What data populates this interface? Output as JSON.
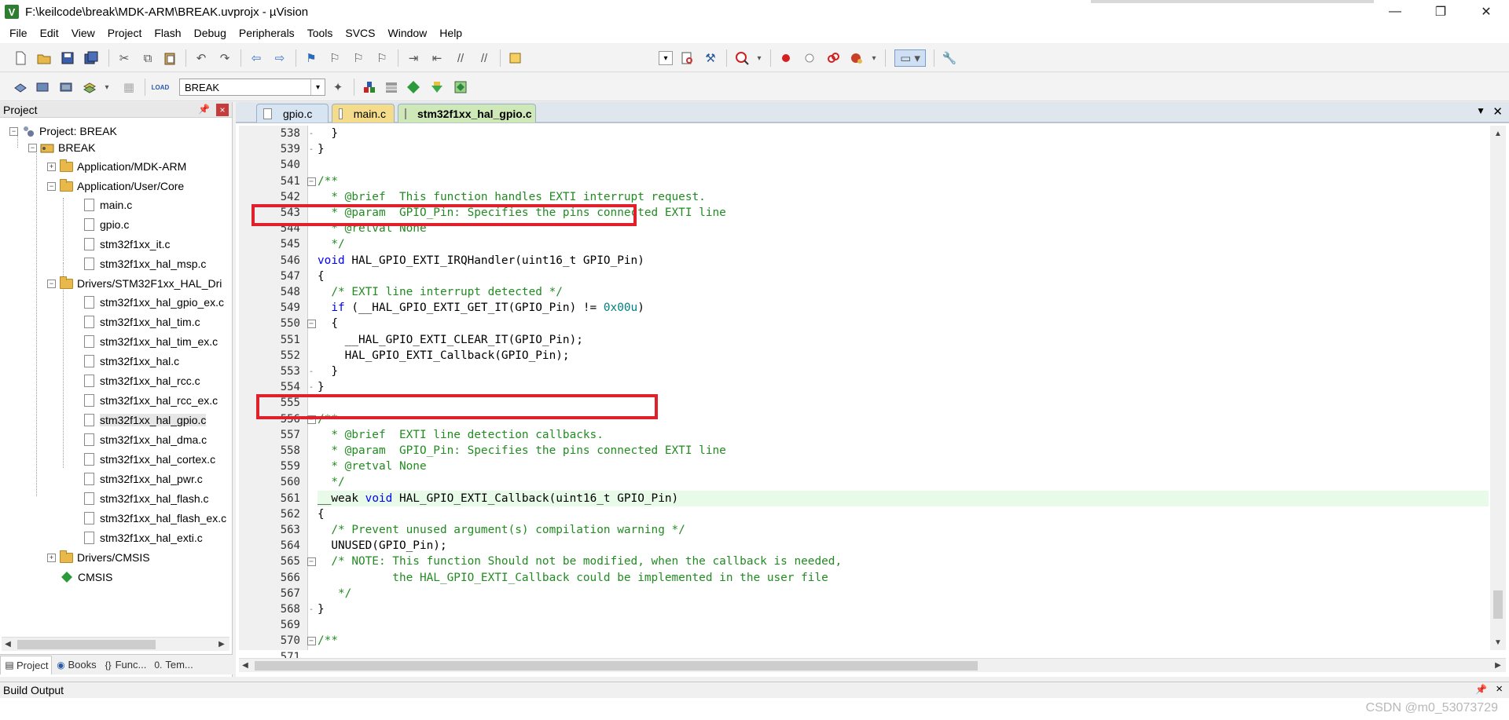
{
  "window": {
    "title": "F:\\keilcode\\break\\MDK-ARM\\BREAK.uvprojx - µVision",
    "app_icon_letter": "V",
    "minimize": "—",
    "maximize": "❐",
    "close": "✕"
  },
  "menu": [
    "File",
    "Edit",
    "View",
    "Project",
    "Flash",
    "Debug",
    "Peripherals",
    "Tools",
    "SVCS",
    "Window",
    "Help"
  ],
  "toolbar": {
    "target": "BREAK",
    "load_label": "LOAD"
  },
  "project_panel": {
    "title": "Project",
    "pin": "📌",
    "close": "×",
    "tree": {
      "root": "Project: BREAK",
      "target": "BREAK",
      "groups": [
        {
          "name": "Application/MDK-ARM"
        },
        {
          "name": "Application/User/Core",
          "files": [
            "main.c",
            "gpio.c",
            "stm32f1xx_it.c",
            "stm32f1xx_hal_msp.c"
          ]
        },
        {
          "name": "Drivers/STM32F1xx_HAL_Dri",
          "files": [
            "stm32f1xx_hal_gpio_ex.c",
            "stm32f1xx_hal_tim.c",
            "stm32f1xx_hal_tim_ex.c",
            "stm32f1xx_hal.c",
            "stm32f1xx_hal_rcc.c",
            "stm32f1xx_hal_rcc_ex.c",
            "stm32f1xx_hal_gpio.c",
            "stm32f1xx_hal_dma.c",
            "stm32f1xx_hal_cortex.c",
            "stm32f1xx_hal_pwr.c",
            "stm32f1xx_hal_flash.c",
            "stm32f1xx_hal_flash_ex.c",
            "stm32f1xx_hal_exti.c"
          ]
        },
        {
          "name": "Drivers/CMSIS"
        }
      ],
      "cmsis": "CMSIS",
      "selected_file": "stm32f1xx_hal_gpio.c"
    },
    "tabs": [
      "Project",
      "Books",
      "Func...",
      "Tem..."
    ]
  },
  "editor": {
    "tabs": [
      "gpio.c",
      "main.c",
      "stm32f1xx_hal_gpio.c"
    ],
    "active_tab": "stm32f1xx_hal_gpio.c",
    "lines": [
      {
        "n": "538",
        "fold": "-",
        "parts": [
          [
            "",
            "  }"
          ]
        ]
      },
      {
        "n": "539",
        "fold": "-",
        "parts": [
          [
            "",
            "}"
          ]
        ]
      },
      {
        "n": "540",
        "fold": "",
        "parts": []
      },
      {
        "n": "541",
        "fold": "box",
        "parts": [
          [
            "cm",
            "/**"
          ]
        ]
      },
      {
        "n": "542",
        "fold": "",
        "parts": [
          [
            "cm",
            "  * @brief  This function handles EXTI interrupt request."
          ]
        ]
      },
      {
        "n": "543",
        "fold": "",
        "parts": [
          [
            "cm",
            "  * @param  GPIO_Pin: Specifies the pins connected EXTI line"
          ]
        ]
      },
      {
        "n": "544",
        "fold": "",
        "parts": [
          [
            "cm",
            "  * @retval None"
          ]
        ]
      },
      {
        "n": "545",
        "fold": "",
        "parts": [
          [
            "cm",
            "  */"
          ]
        ]
      },
      {
        "n": "546",
        "fold": "",
        "parts": [
          [
            "kw",
            "void"
          ],
          [
            "",
            " HAL_GPIO_EXTI_IRQHandler(uint16_t GPIO_Pin)"
          ]
        ]
      },
      {
        "n": "547",
        "fold": "",
        "parts": [
          [
            "",
            "{"
          ]
        ]
      },
      {
        "n": "548",
        "fold": "",
        "parts": [
          [
            "cm",
            "  /* EXTI line interrupt detected */"
          ]
        ]
      },
      {
        "n": "549",
        "fold": "",
        "parts": [
          [
            "",
            "  "
          ],
          [
            "kw",
            "if"
          ],
          [
            "",
            " (__HAL_GPIO_EXTI_GET_IT(GPIO_Pin) != "
          ],
          [
            "nm",
            "0x00u"
          ],
          [
            "",
            ")"
          ]
        ]
      },
      {
        "n": "550",
        "fold": "box",
        "parts": [
          [
            "",
            "  {"
          ]
        ]
      },
      {
        "n": "551",
        "fold": "",
        "parts": [
          [
            "",
            "    __HAL_GPIO_EXTI_CLEAR_IT(GPIO_Pin);"
          ]
        ]
      },
      {
        "n": "552",
        "fold": "",
        "parts": [
          [
            "",
            "    HAL_GPIO_EXTI_Callback(GPIO_Pin);"
          ]
        ]
      },
      {
        "n": "553",
        "fold": "-",
        "parts": [
          [
            "",
            "  }"
          ]
        ]
      },
      {
        "n": "554",
        "fold": "-",
        "parts": [
          [
            "",
            "}"
          ]
        ]
      },
      {
        "n": "555",
        "fold": "",
        "parts": []
      },
      {
        "n": "556",
        "fold": "box",
        "parts": [
          [
            "cm",
            "/**"
          ]
        ]
      },
      {
        "n": "557",
        "fold": "",
        "parts": [
          [
            "cm",
            "  * @brief  EXTI line detection callbacks."
          ]
        ]
      },
      {
        "n": "558",
        "fold": "",
        "parts": [
          [
            "cm",
            "  * @param  GPIO_Pin: Specifies the pins connected EXTI line"
          ]
        ]
      },
      {
        "n": "559",
        "fold": "",
        "parts": [
          [
            "cm",
            "  * @retval None"
          ]
        ]
      },
      {
        "n": "560",
        "fold": "",
        "parts": [
          [
            "cm",
            "  */"
          ]
        ]
      },
      {
        "n": "561",
        "fold": "",
        "parts": [
          [
            "",
            "__weak "
          ],
          [
            "kw",
            "void"
          ],
          [
            "",
            " HAL_GPIO_EXTI_Callback(uint16_t GPIO_Pin)"
          ]
        ]
      },
      {
        "n": "562",
        "fold": "",
        "parts": [
          [
            "",
            "{"
          ]
        ]
      },
      {
        "n": "563",
        "fold": "",
        "parts": [
          [
            "cm",
            "  /* Prevent unused argument(s) compilation warning */"
          ]
        ]
      },
      {
        "n": "564",
        "fold": "",
        "parts": [
          [
            "",
            "  UNUSED(GPIO_Pin);"
          ]
        ]
      },
      {
        "n": "565",
        "fold": "box",
        "parts": [
          [
            "cm",
            "  /* NOTE: This function Should not be modified, when the callback is needed,"
          ]
        ]
      },
      {
        "n": "566",
        "fold": "",
        "parts": [
          [
            "cm",
            "           the HAL_GPIO_EXTI_Callback could be implemented in the user file"
          ]
        ]
      },
      {
        "n": "567",
        "fold": "",
        "parts": [
          [
            "cm",
            "   */"
          ]
        ]
      },
      {
        "n": "568",
        "fold": "-",
        "parts": [
          [
            "",
            "}"
          ]
        ]
      },
      {
        "n": "569",
        "fold": "",
        "parts": []
      },
      {
        "n": "570",
        "fold": "box",
        "parts": [
          [
            "cm",
            "/**"
          ]
        ]
      },
      {
        "n": "571",
        "fold": "",
        "parts": [
          [
            "cm",
            "  * @}"
          ]
        ]
      }
    ],
    "highlighted_line": "561"
  },
  "build_output": {
    "title": "Build Output",
    "pin": "📌",
    "close": "×"
  },
  "watermark": "CSDN @m0_53073729",
  "colors": {
    "comment": "#228b22",
    "keyword": "#0000ff",
    "number": "#008080",
    "annotation_box": "#e0202a",
    "current_line": "#e8fbe8"
  }
}
